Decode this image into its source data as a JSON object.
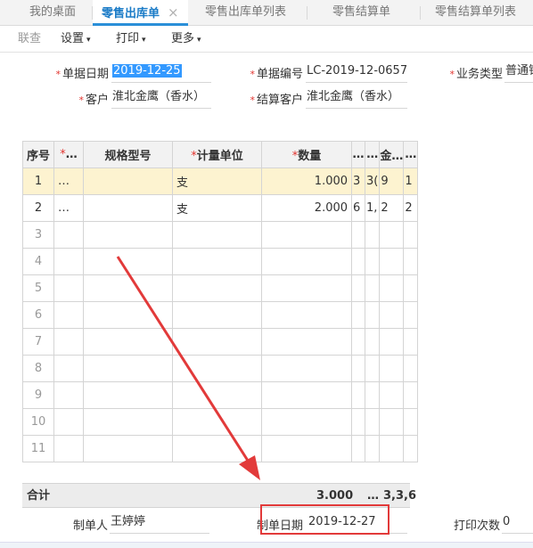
{
  "tabs": [
    {
      "label": "我的桌面"
    },
    {
      "label": "零售出库单",
      "close": "×"
    },
    {
      "label": "零售出库单列表"
    },
    {
      "label": "零售结算单"
    },
    {
      "label": "零售结算单列表"
    }
  ],
  "toolbar": {
    "link": "联查",
    "settings": "设置",
    "print": "打印",
    "more": "更多",
    "caret": "▾"
  },
  "form": {
    "required_mark": "*",
    "date_label": "单据日期",
    "date_value": "2019-12-25",
    "number_label": "单据编号",
    "number_value": "LC-2019-12-0657",
    "biz_type_label": "业务类型",
    "biz_type_value": "普通销",
    "customer_label": "客户",
    "customer_value": "淮北金鹰（香水）",
    "settle_customer_label": "结算客户",
    "settle_customer_value": "淮北金鹰（香水）"
  },
  "grid": {
    "headers": [
      "序号",
      "…",
      "规格型号",
      "计量单位",
      "数量",
      "…",
      "…",
      "金…",
      "…"
    ],
    "rows": [
      {
        "no": "1",
        "c1": "…",
        "spec": "",
        "unit": "支",
        "qty": "1.000",
        "a": "3",
        "b": "3(",
        "c": "9",
        "d": "1"
      },
      {
        "no": "2",
        "c1": "…",
        "spec": "",
        "unit": "支",
        "qty": "2.000",
        "a": "6",
        "b": "1,",
        "c": "2",
        "d": "2"
      }
    ],
    "empty_rows": [
      "3",
      "4",
      "5",
      "6",
      "7",
      "8",
      "9",
      "10",
      "11"
    ]
  },
  "summary": {
    "label": "合计",
    "qty": "3.000",
    "ellipsis": "…",
    "amount": "3,3,6"
  },
  "footer": {
    "maker_label": "制单人",
    "maker_value": "王婷婷",
    "make_date_label": "制单日期",
    "make_date_value": "2019-12-27",
    "print_count_label": "打印次数",
    "print_count_value": "0"
  },
  "colors": {
    "accent": "#2a8fd8",
    "required": "#e2342f",
    "highlight_row": "#fdf3d0",
    "annotation": "#e23a3a"
  }
}
